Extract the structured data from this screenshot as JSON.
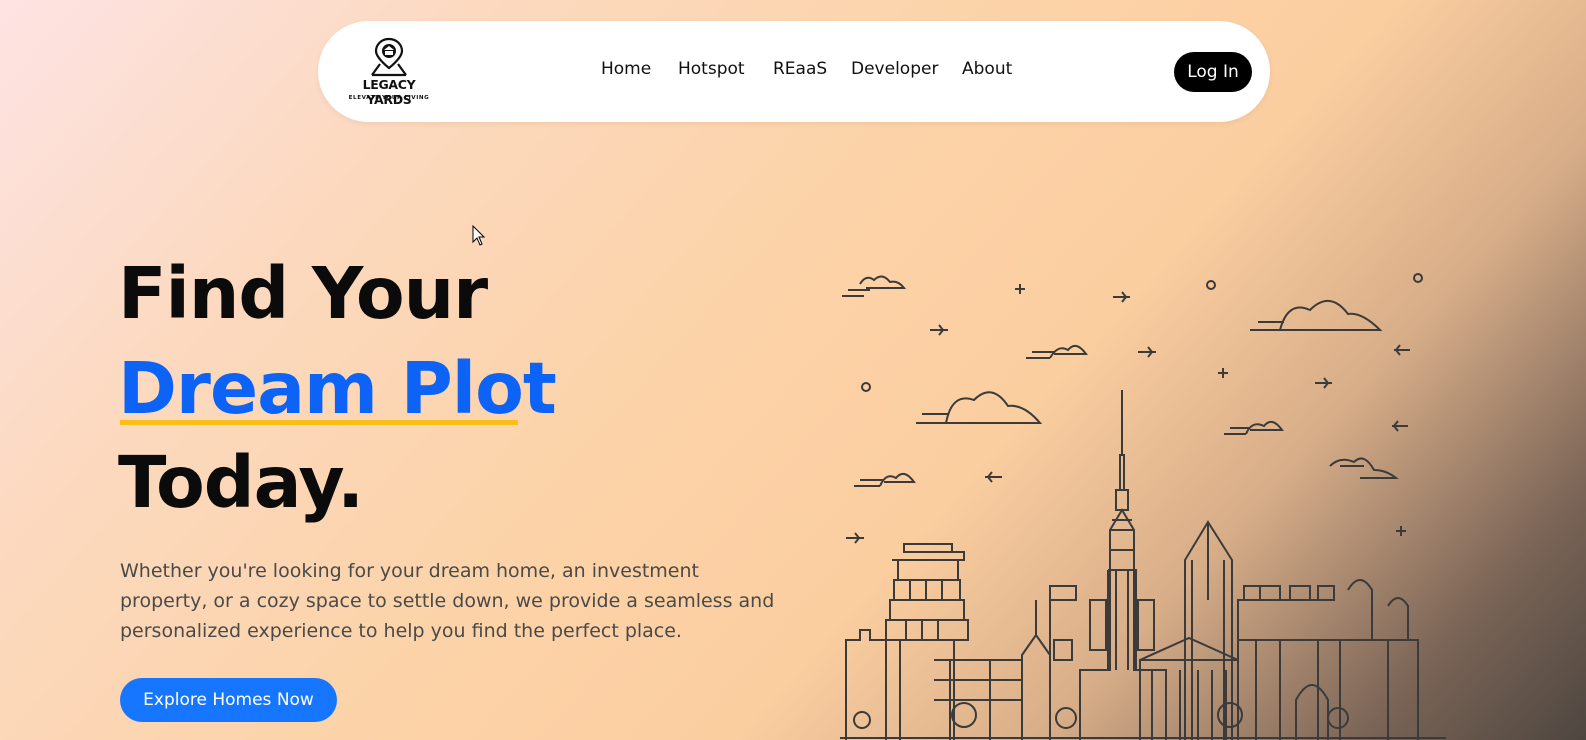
{
  "brand": {
    "name": "LEGACY YARDS",
    "tagline": "ELEVATE YOUR LIVING"
  },
  "nav": {
    "items": [
      "Home",
      "Hotspot",
      "REaaS",
      "Developer",
      "About"
    ],
    "login_label": "Log In"
  },
  "hero": {
    "line1": "Find Your",
    "line2": "Dream Plot",
    "line3": "Today.",
    "description": "Whether you're looking for your dream home, an investment property, or a cozy space to settle down, we provide a seamless and personalized experience to help you find the perfect place.",
    "cta_label": "Explore Homes Now"
  },
  "colors": {
    "accent": "#0d63f5",
    "underline": "#f7bf17",
    "cta": "#1676ff",
    "login_bg": "#000000"
  },
  "icons": {
    "logo": "location-pin-temple-icon",
    "illustration": "city-skyline-illustration",
    "cursor": "mouse-pointer-icon"
  }
}
